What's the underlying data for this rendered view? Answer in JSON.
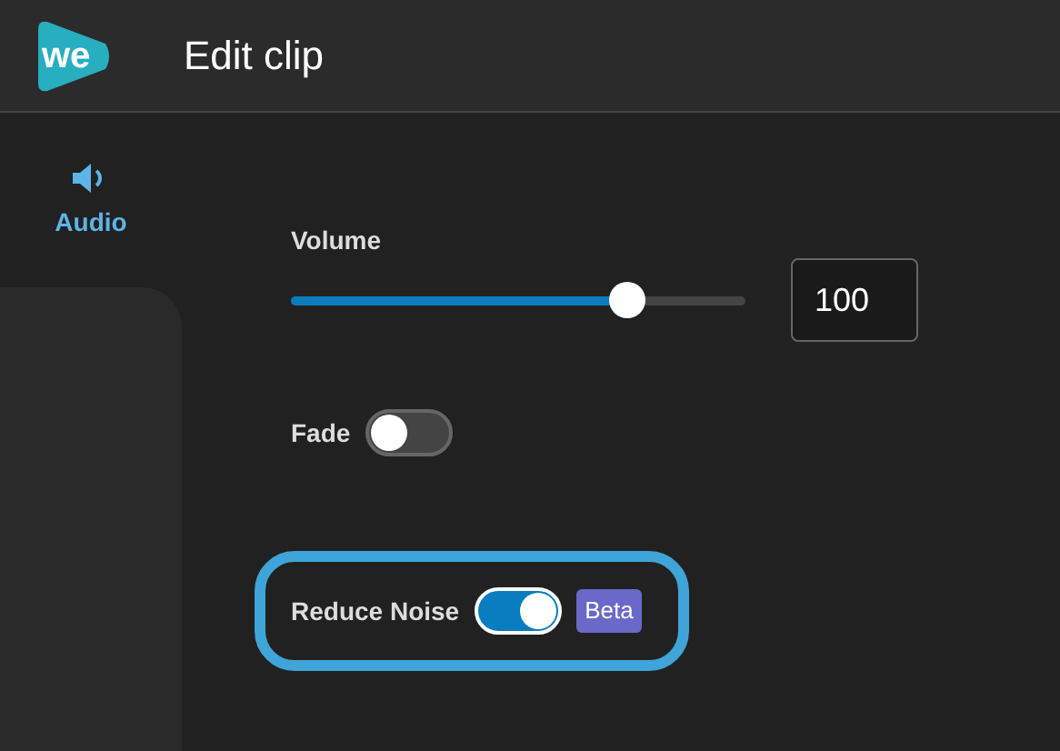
{
  "header": {
    "logo_text": "we",
    "title": "Edit clip"
  },
  "sidebar": {
    "tabs": [
      {
        "label": "Audio",
        "selected": true
      }
    ]
  },
  "volume": {
    "label": "Volume",
    "level": 0.74,
    "value": "100"
  },
  "toggles": [
    {
      "label": "Fade",
      "on": false,
      "highlighted": false
    },
    {
      "label": "Reduce Noise",
      "on": true,
      "highlighted": true,
      "badge": "Beta"
    }
  ]
}
